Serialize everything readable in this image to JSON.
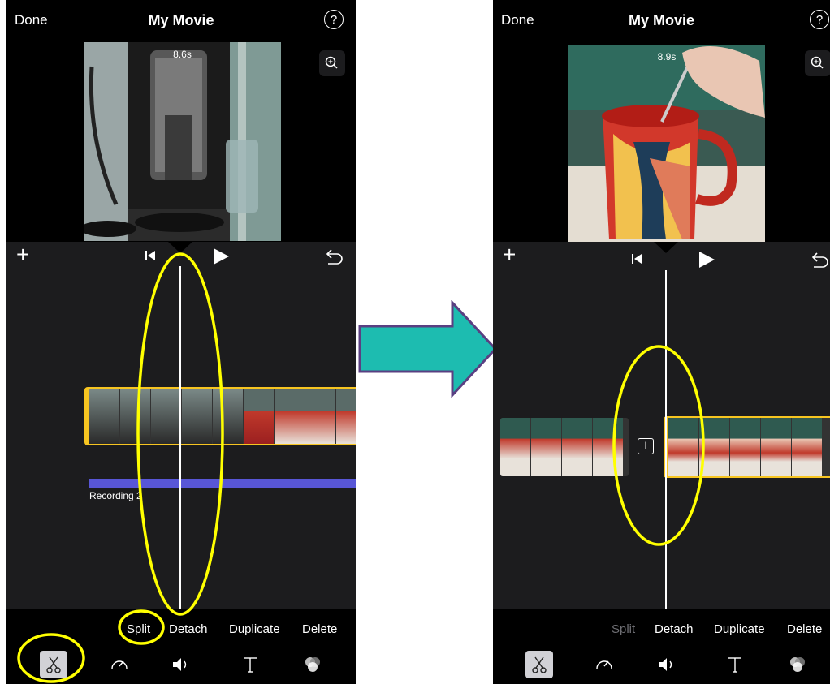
{
  "left": {
    "done_label": "Done",
    "title": "My Movie",
    "help_label": "?",
    "duration": "8.6s",
    "audio_track_label": "Recording 2",
    "actions": [
      "Split",
      "Detach",
      "Duplicate",
      "Delete"
    ],
    "selected_tool": "scissors-icon"
  },
  "right": {
    "done_label": "Done",
    "title": "My Movie",
    "help_label": "?",
    "duration": "8.9s",
    "transition_label": "I",
    "actions": [
      "Split",
      "Detach",
      "Duplicate",
      "Delete"
    ],
    "disabled_action": "Split",
    "selected_tool": "scissors-icon"
  },
  "tools": [
    "scissors-icon",
    "speed-icon",
    "volume-icon",
    "titles-icon",
    "filters-icon"
  ],
  "colors": {
    "annotation": "#ffff00",
    "arrow_fill": "#1dbcb0",
    "arrow_border": "#5a3f82",
    "clip_border": "#f7c521",
    "audio_bar": "#5856d6",
    "editor_bg": "#1c1c1e"
  }
}
